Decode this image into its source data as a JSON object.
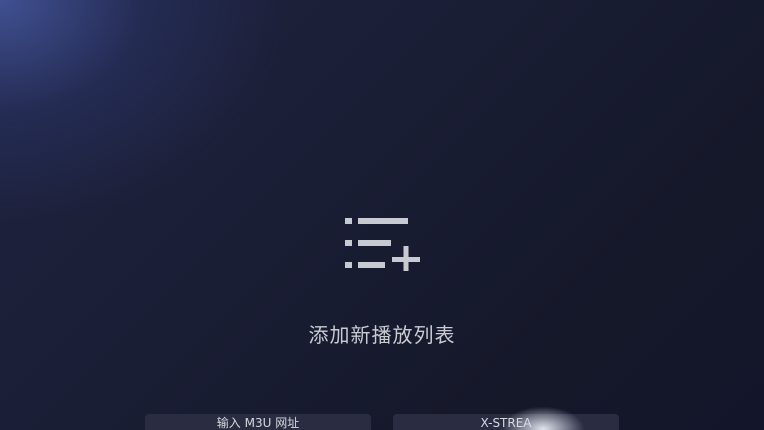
{
  "empty_state": {
    "icon": "playlist-add-icon",
    "title": "添加新播放列表"
  },
  "actions": {
    "m3u_label": "输入 M3U 网址",
    "xstream_label": "X-STREA"
  },
  "colors": {
    "background_dark": "#171a2b",
    "background_glow": "#4658a0",
    "icon": "#c8cad1",
    "text": "#c9cbd3",
    "button_bg": "#2a2d42"
  }
}
